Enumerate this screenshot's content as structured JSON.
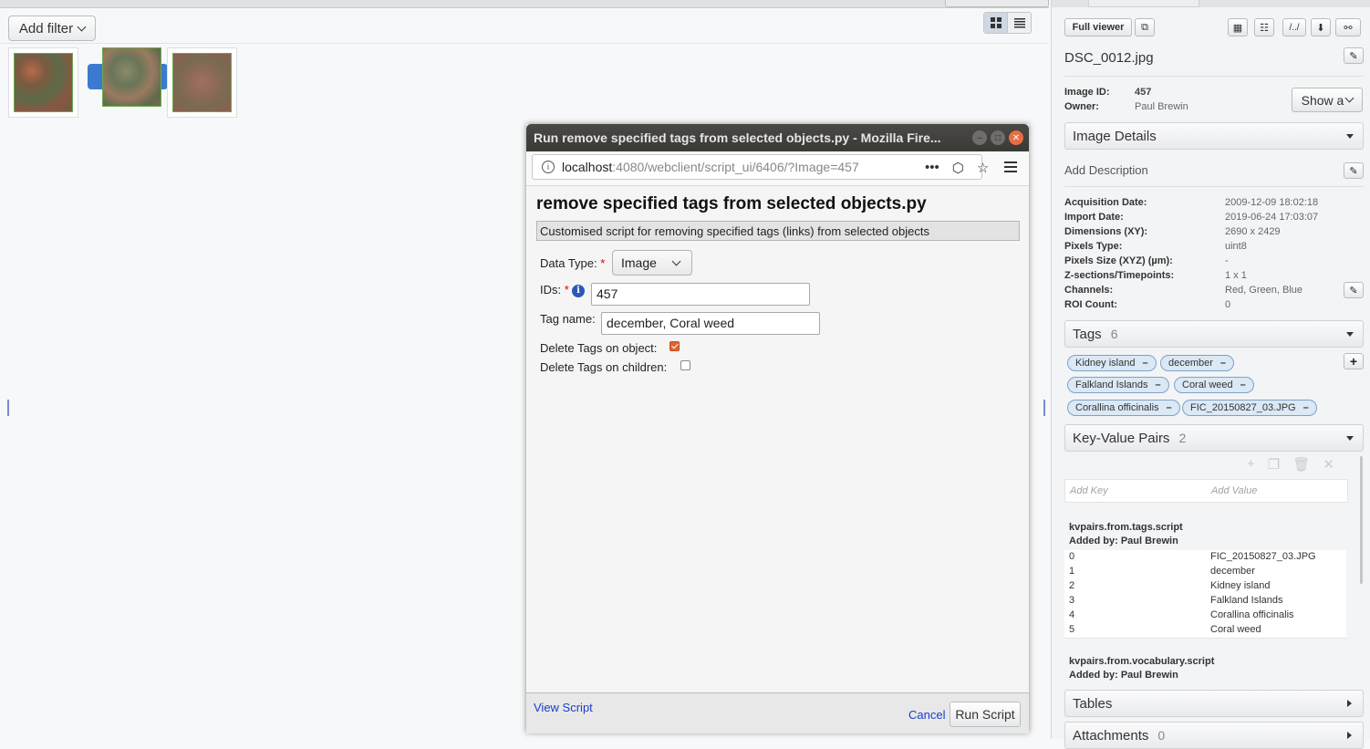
{
  "left": {
    "add_filter": "Add filter",
    "thumbnails": [
      {
        "name": "thumbnail-1",
        "selected": false
      },
      {
        "name": "thumbnail-2",
        "selected": true
      },
      {
        "name": "thumbnail-3",
        "selected": false
      }
    ]
  },
  "right": {
    "full_viewer": "Full viewer",
    "file_name": "DSC_0012.jpg",
    "image_id_label": "Image ID:",
    "image_id": "457",
    "owner_label": "Owner:",
    "owner": "Paul Brewin",
    "show_all": "Show a",
    "image_details": "Image Details",
    "add_description": "Add Description",
    "details": [
      {
        "label": "Acquisition Date:",
        "value": "2009-12-09 18:02:18"
      },
      {
        "label": "Import Date:",
        "value": "2019-06-24 17:03:07"
      },
      {
        "label": "Dimensions (XY):",
        "value": "2690 x 2429"
      },
      {
        "label": "Pixels Type:",
        "value": "uint8"
      },
      {
        "label": "Pixels Size (XYZ) (µm):",
        "value": "-"
      },
      {
        "label": "Z-sections/Timepoints:",
        "value": "1 x 1"
      },
      {
        "label": "Channels:",
        "value": "Red, Green, Blue"
      },
      {
        "label": "ROI Count:",
        "value": "0"
      }
    ],
    "tags_label": "Tags",
    "tags_count": "6",
    "tags": [
      "Kidney island",
      "december",
      "Falkland Islands",
      "Coral weed",
      "Corallina officinalis",
      "FIC_20150827_03.JPG"
    ],
    "tag_remove": "–",
    "kv_label": "Key-Value Pairs",
    "kv_count": "2",
    "add_key": "Add Key",
    "add_value": "Add Value",
    "kv_groups": [
      {
        "name": "kvpairs.from.tags.script",
        "added_by": "Added by: Paul Brewin",
        "rows": [
          {
            "k": "0",
            "v": "FIC_20150827_03.JPG"
          },
          {
            "k": "1",
            "v": "december"
          },
          {
            "k": "2",
            "v": "Kidney island"
          },
          {
            "k": "3",
            "v": "Falkland Islands"
          },
          {
            "k": "4",
            "v": "Corallina officinalis"
          },
          {
            "k": "5",
            "v": "Coral weed"
          }
        ]
      },
      {
        "name": "kvpairs.from.vocabulary.script",
        "added_by": "Added by: Paul Brewin",
        "rows": []
      }
    ],
    "tables": "Tables",
    "attachments": "Attachments",
    "attachments_count": "0"
  },
  "window": {
    "title": "Run remove specified tags from selected objects.py - Mozilla Fire...",
    "url_host": "localhost",
    "url_rest": ":4080/webclient/script_ui/6406/?Image=457",
    "script_title": "remove specified tags from selected objects.py",
    "script_desc": "Customised script for removing specified tags (links) from selected objects",
    "data_type_label": "Data Type:",
    "data_type_value": "Image",
    "ids_label": "IDs:",
    "ids_value": "457",
    "tag_name_label": "Tag name:",
    "tag_name_value": "december, Coral weed",
    "delete_on_object_label": "Delete Tags on object:",
    "delete_on_object": true,
    "delete_on_children_label": "Delete Tags on children:",
    "delete_on_children": false,
    "view_script": "View Script",
    "cancel": "Cancel",
    "run_script": "Run Script",
    "required_mark": "*"
  }
}
